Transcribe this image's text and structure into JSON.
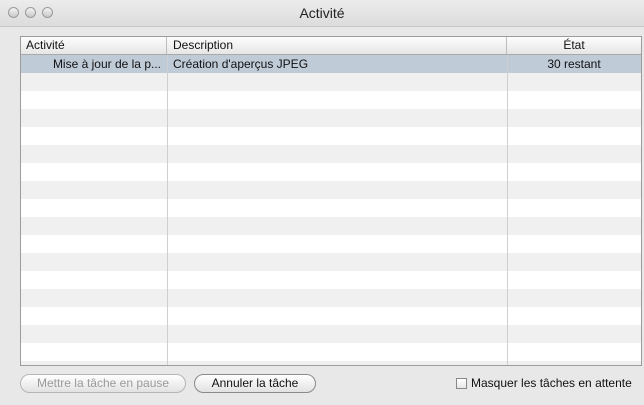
{
  "window": {
    "title": "Activité"
  },
  "table": {
    "columns": [
      "Activité",
      "Description",
      "État"
    ],
    "rows": [
      {
        "activity": "Mise à jour de la p...",
        "description": "Création d'aperçus JPEG",
        "state": "30 restant",
        "selected": true
      }
    ]
  },
  "buttons": {
    "pause_label": "Mettre la tâche en pause",
    "cancel_label": "Annuler la tâche"
  },
  "options": {
    "hide_waiting_label": "Masquer les tâches en attente",
    "hide_waiting_checked": false
  },
  "colors": {
    "selected_row": "#c0cbd8",
    "alt_row": "#f0f0f0"
  }
}
